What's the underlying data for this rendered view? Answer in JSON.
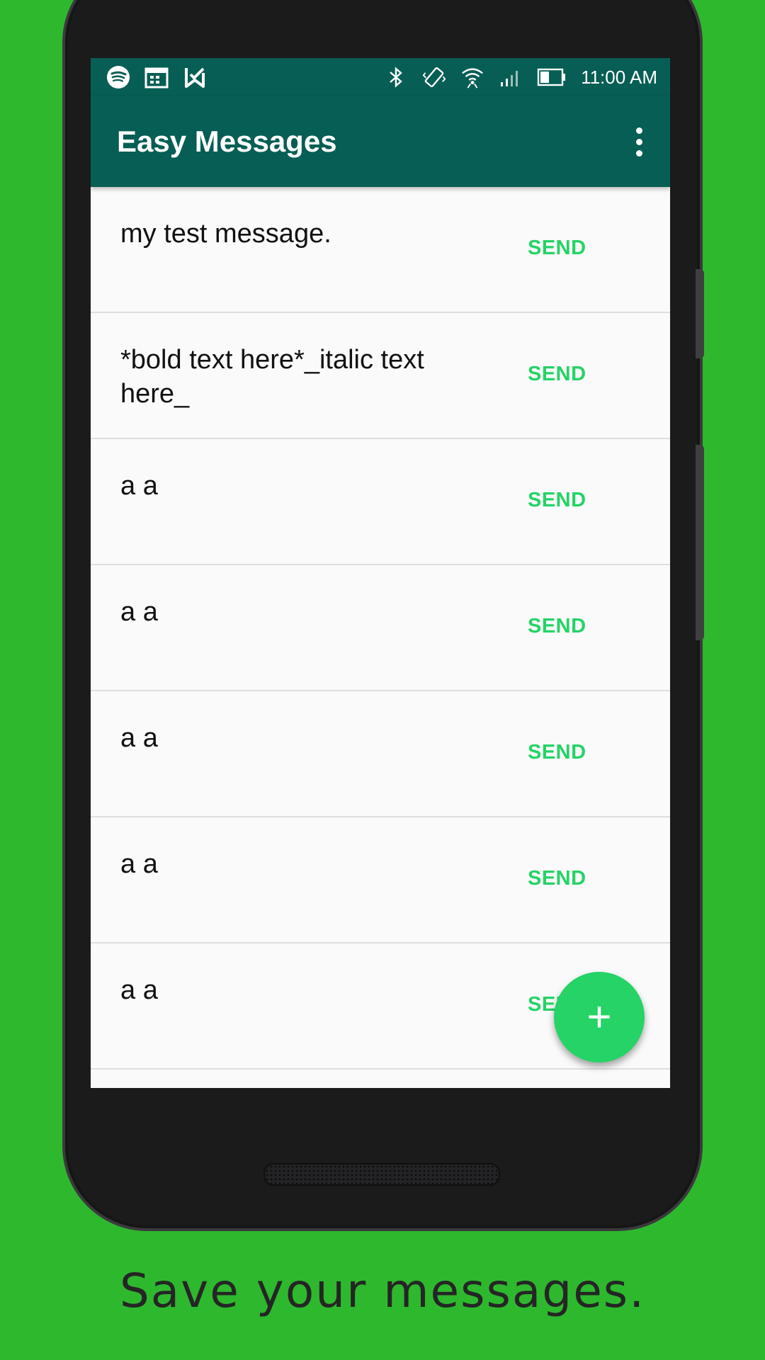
{
  "statusbar": {
    "left_icons": [
      "spotify-icon",
      "calendar-icon",
      "task-icon"
    ],
    "right_icons": [
      "bluetooth-icon",
      "vibrate-icon",
      "wifi-icon",
      "signal-icon",
      "battery-icon"
    ],
    "time": "11:00 AM"
  },
  "appbar": {
    "title": "Easy Messages",
    "menu_icon": "more-vert-icon"
  },
  "messages": [
    {
      "text": "my test message.",
      "action": "SEND"
    },
    {
      "text": "*bold text here*_italic text here_",
      "action": "SEND"
    },
    {
      "text": "a a",
      "action": "SEND"
    },
    {
      "text": "a a",
      "action": "SEND"
    },
    {
      "text": "a a",
      "action": "SEND"
    },
    {
      "text": "a a",
      "action": "SEND"
    },
    {
      "text": "a a",
      "action": "SEND"
    }
  ],
  "fab": {
    "label": "+",
    "icon": "add-icon"
  },
  "caption": "Save your messages.",
  "colors": {
    "background": "#2eb82e",
    "appbar": "#075e54",
    "accent": "#25d366"
  }
}
